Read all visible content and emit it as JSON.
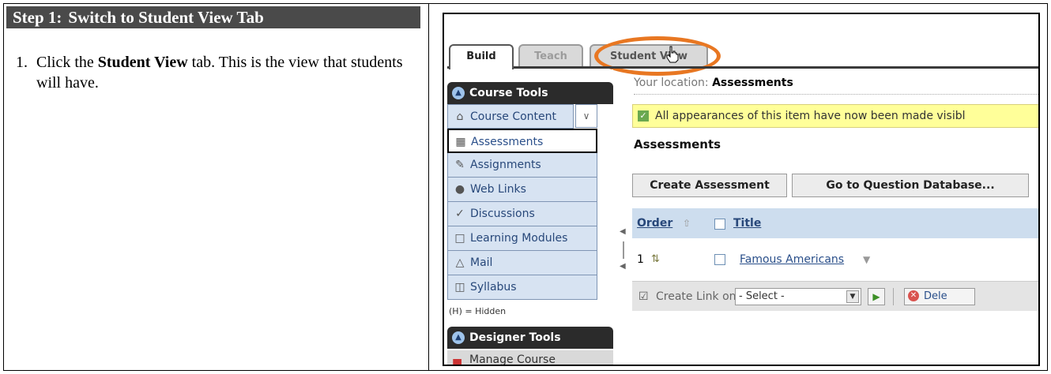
{
  "step": {
    "number": "Step 1:",
    "title": "Switch to Student View Tab"
  },
  "instruction": {
    "index": "1.",
    "before": "Click the ",
    "bold": "Student View",
    "after": " tab. This is the view that students will have."
  },
  "app": {
    "tabs": [
      "Build",
      "Teach",
      "Student View"
    ],
    "course_tools_title": "Course Tools",
    "nav_items": [
      {
        "label": "Course Content",
        "icon": "home-icon"
      },
      {
        "label": "Assessments",
        "icon": "assessment-icon"
      },
      {
        "label": "Assignments",
        "icon": "assignment-icon"
      },
      {
        "label": "Web Links",
        "icon": "weblink-icon"
      },
      {
        "label": "Discussions",
        "icon": "discussion-icon"
      },
      {
        "label": "Learning Modules",
        "icon": "module-icon"
      },
      {
        "label": "Mail",
        "icon": "mail-icon"
      },
      {
        "label": "Syllabus",
        "icon": "syllabus-icon"
      }
    ],
    "hidden_note": "(H) = Hidden",
    "designer_tools_title": "Designer Tools",
    "manage_course": "Manage Course",
    "location_label": "Your location:",
    "location_value": "Assessments",
    "notice": "All appearances of this item have now been made visibl",
    "section_title": "Assessments",
    "buttons": {
      "create": "Create Assessment",
      "question_db": "Go to Question Database..."
    },
    "list": {
      "col_order": "Order",
      "col_title": "Title",
      "rows": [
        {
          "index": "1",
          "title": "Famous Americans"
        }
      ]
    },
    "toolbar": {
      "create_link_label": "Create Link on:",
      "select_value": "- Select -",
      "delete_label": "Dele"
    },
    "colors": {
      "highlight_ring": "#e87722",
      "notice_bg": "#ffff99",
      "nav_bg": "#d7e3f2"
    }
  }
}
